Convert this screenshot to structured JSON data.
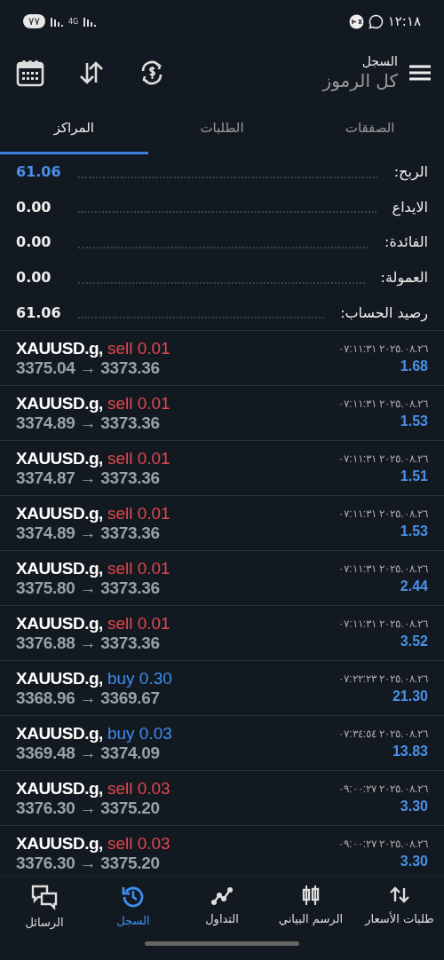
{
  "status_bar": {
    "time": "١٢:١٨",
    "battery": "٧٧",
    "network": "4G"
  },
  "header": {
    "title": "السجل",
    "subtitle": "كل الرموز"
  },
  "tabs": [
    {
      "label": "الصفقات",
      "selected": false
    },
    {
      "label": "الطلبات",
      "selected": false
    },
    {
      "label": "المراكز",
      "selected": true
    }
  ],
  "summary": [
    {
      "label": "الربح:",
      "value": "61.06",
      "kind": "profit"
    },
    {
      "label": "الايداع",
      "value": "0.00",
      "kind": "plain"
    },
    {
      "label": "الفائدة:",
      "value": "0.00",
      "kind": "plain"
    },
    {
      "label": "العمولة:",
      "value": "0.00",
      "kind": "plain"
    },
    {
      "label": "رصيد الحساب:",
      "value": "61.06",
      "kind": "plain"
    }
  ],
  "trades": [
    {
      "symbol": "XAUUSD.g,",
      "side": "sell",
      "volume": "0.01",
      "prices": "3375.04 → 3373.36",
      "time": "٢٠٢٥.٠٨.٢٦ ٠٧:١١:٣١",
      "profit": "1.68"
    },
    {
      "symbol": "XAUUSD.g,",
      "side": "sell",
      "volume": "0.01",
      "prices": "3374.89 → 3373.36",
      "time": "٢٠٢٥.٠٨.٢٦ ٠٧:١١:٣١",
      "profit": "1.53"
    },
    {
      "symbol": "XAUUSD.g,",
      "side": "sell",
      "volume": "0.01",
      "prices": "3374.87 → 3373.36",
      "time": "٢٠٢٥.٠٨.٢٦ ٠٧:١١:٣١",
      "profit": "1.51"
    },
    {
      "symbol": "XAUUSD.g,",
      "side": "sell",
      "volume": "0.01",
      "prices": "3374.89 → 3373.36",
      "time": "٢٠٢٥.٠٨.٢٦ ٠٧:١١:٣١",
      "profit": "1.53"
    },
    {
      "symbol": "XAUUSD.g,",
      "side": "sell",
      "volume": "0.01",
      "prices": "3375.80 → 3373.36",
      "time": "٢٠٢٥.٠٨.٢٦ ٠٧:١١:٣١",
      "profit": "2.44"
    },
    {
      "symbol": "XAUUSD.g,",
      "side": "sell",
      "volume": "0.01",
      "prices": "3376.88 → 3373.36",
      "time": "٢٠٢٥.٠٨.٢٦ ٠٧:١١:٣١",
      "profit": "3.52"
    },
    {
      "symbol": "XAUUSD.g,",
      "side": "buy",
      "volume": "0.30",
      "prices": "3368.96 → 3369.67",
      "time": "٢٠٢٥.٠٨.٢٦ ٠٧:٢٢:٢٣",
      "profit": "21.30"
    },
    {
      "symbol": "XAUUSD.g,",
      "side": "buy",
      "volume": "0.03",
      "prices": "3369.48 → 3374.09",
      "time": "٢٠٢٥.٠٨.٢٦ ٠٧:٣٤:٥٤",
      "profit": "13.83"
    },
    {
      "symbol": "XAUUSD.g,",
      "side": "sell",
      "volume": "0.03",
      "prices": "3376.30 → 3375.20",
      "time": "٢٠٢٥.٠٨.٢٦ ٠٩:٠٠:٢٧",
      "profit": "3.30"
    },
    {
      "symbol": "XAUUSD.g,",
      "side": "sell",
      "volume": "0.03",
      "prices": "3376.30 → 3375.20",
      "time": "٢٠٢٥.٠٨.٢٦ ٠٩:٠٠:٢٧",
      "profit": "3.30"
    }
  ],
  "nav": [
    {
      "label": "طلبات الأسعار",
      "selected": false
    },
    {
      "label": "الرسم البياني",
      "selected": false
    },
    {
      "label": "التداول",
      "selected": false
    },
    {
      "label": "السجل",
      "selected": true
    },
    {
      "label": "الرسائل",
      "selected": false
    }
  ]
}
